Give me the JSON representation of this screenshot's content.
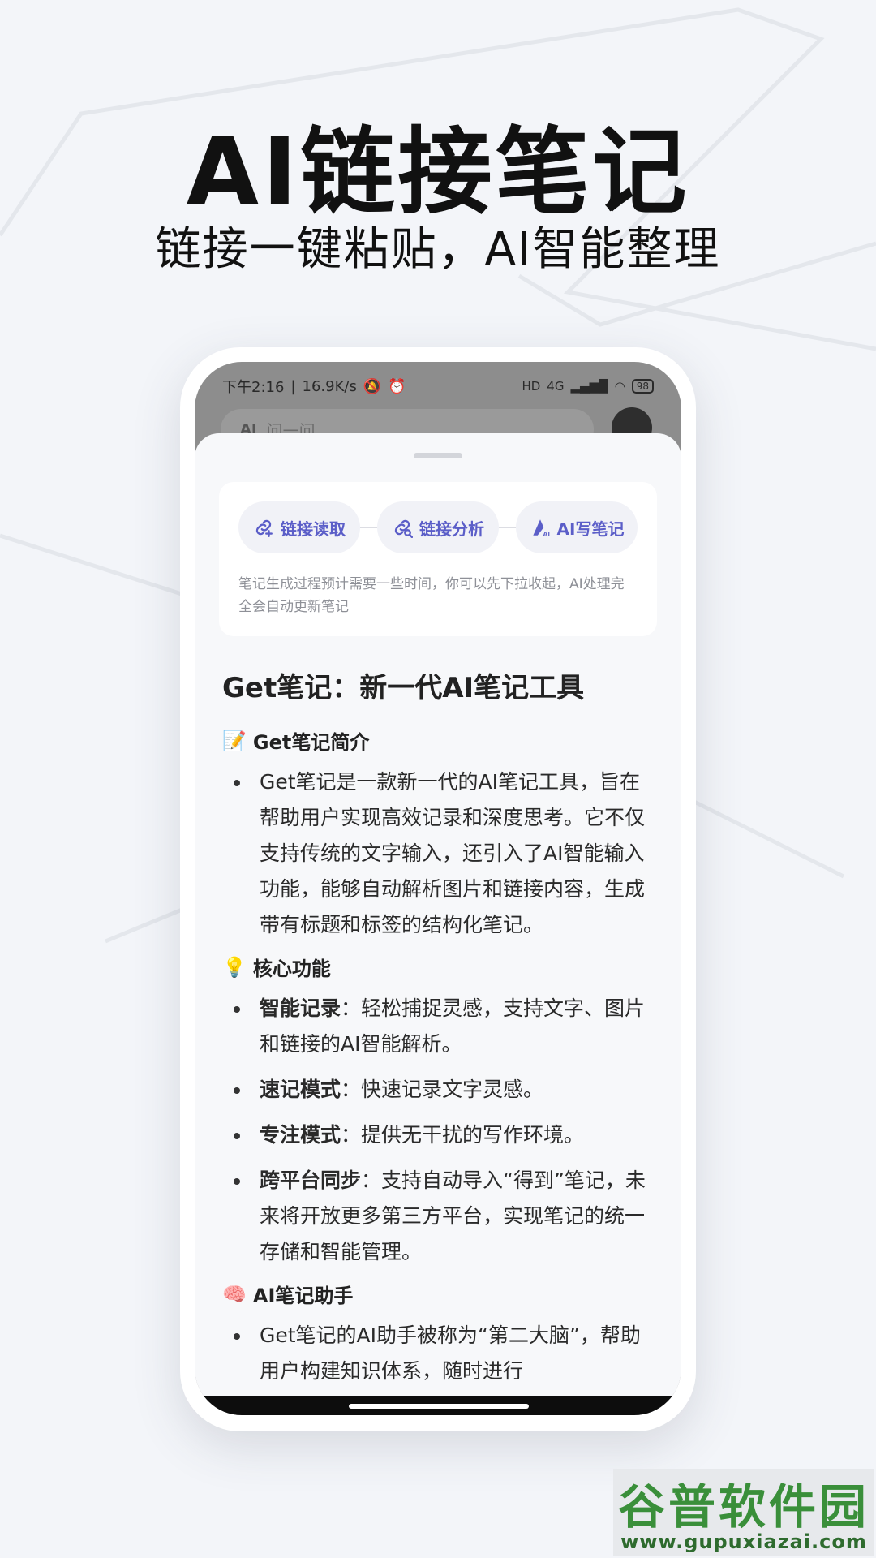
{
  "hero": {
    "title": "AI链接笔记",
    "subtitle": "链接一键粘贴，AI智能整理"
  },
  "status_bar": {
    "time": "下午2:16",
    "speed": "16.9K/s",
    "network": "4G",
    "battery": "98"
  },
  "search": {
    "logo": "AI",
    "placeholder": "问一问"
  },
  "progress": {
    "steps": [
      {
        "label": "链接读取",
        "icon": "link-read-icon"
      },
      {
        "label": "链接分析",
        "icon": "link-analyze-icon"
      },
      {
        "label": "AI写笔记",
        "icon": "ai-write-icon"
      }
    ],
    "note": "笔记生成过程预计需要一些时间，你可以先下拉收起，AI处理完全会自动更新笔记"
  },
  "note": {
    "title": "Get笔记：新一代AI笔记工具",
    "sections": [
      {
        "emoji": "📝",
        "heading": "Get笔记简介",
        "items": [
          {
            "bold": "",
            "text": "Get笔记是一款新一代的AI笔记工具，旨在帮助用户实现高效记录和深度思考。它不仅支持传统的文字输入，还引入了AI智能输入功能，能够自动解析图片和链接内容，生成带有标题和标签的结构化笔记。"
          }
        ]
      },
      {
        "emoji": "💡",
        "heading": "核心功能",
        "items": [
          {
            "bold": "智能记录",
            "text": "：轻松捕捉灵感，支持文字、图片和链接的AI智能解析。"
          },
          {
            "bold": "速记模式",
            "text": "：快速记录文字灵感。"
          },
          {
            "bold": "专注模式",
            "text": "：提供无干扰的写作环境。"
          },
          {
            "bold": "跨平台同步",
            "text": "：支持自动导入“得到”笔记，未来将开放更多第三方平台，实现笔记的统一存储和智能管理。"
          }
        ]
      },
      {
        "emoji": "🧠",
        "heading": "AI笔记助手",
        "items": [
          {
            "bold": "",
            "text": "Get笔记的AI助手被称为“第二大脑”，帮助用户构建知识体系，随时进行"
          }
        ]
      }
    ]
  },
  "watermark": {
    "name": "谷普软件园",
    "url": "www.gupuxiazai.com"
  }
}
